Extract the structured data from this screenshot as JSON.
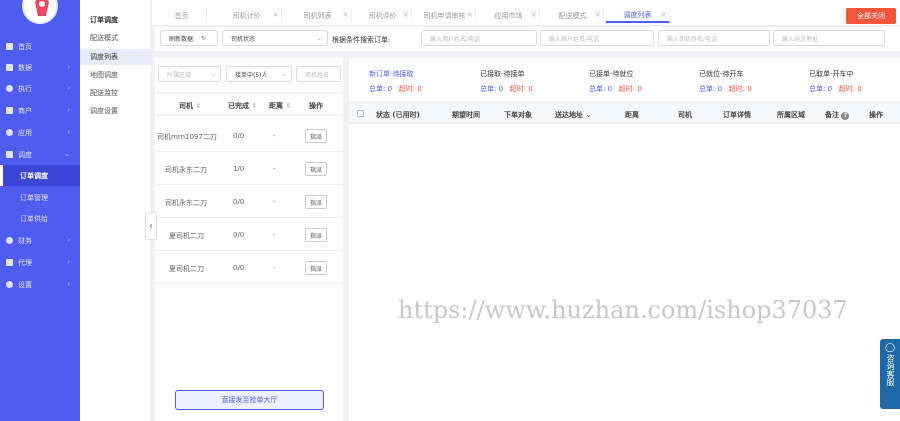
{
  "sidebar": {
    "items": [
      {
        "label": "首页",
        "icon": "home-icon"
      },
      {
        "label": "数据",
        "icon": "chart-icon"
      },
      {
        "label": "执行",
        "icon": "play-icon"
      },
      {
        "label": "商户",
        "icon": "shop-icon"
      },
      {
        "label": "应用",
        "icon": "app-icon"
      },
      {
        "label": "调度",
        "icon": "schedule-icon"
      }
    ],
    "sub_items": [
      {
        "label": "订单调度",
        "active": true
      },
      {
        "label": "订单管理"
      },
      {
        "label": "订单供给"
      }
    ],
    "more_items": [
      {
        "label": "财务",
        "icon": "finance-icon"
      },
      {
        "label": "代理",
        "icon": "agent-icon"
      },
      {
        "label": "设置",
        "icon": "settings-icon"
      }
    ]
  },
  "secondary_nav": {
    "items": [
      {
        "label": "订单调度",
        "head": true
      },
      {
        "label": "配送模式"
      },
      {
        "label": "调度列表",
        "active": true
      },
      {
        "label": "地图调度"
      },
      {
        "label": "配送监控"
      },
      {
        "label": "调度设置"
      }
    ]
  },
  "tabs": [
    {
      "label": "首页"
    },
    {
      "label": "司机计价"
    },
    {
      "label": "司机列表"
    },
    {
      "label": "司机评价"
    },
    {
      "label": "司机申请审核"
    },
    {
      "label": "应用市场"
    },
    {
      "label": "配送模式"
    },
    {
      "label": "调度列表",
      "active": true
    }
  ],
  "close_all_label": "全部关闭",
  "filters": {
    "refresh_label": "刷新数据",
    "status_select": "司机状态",
    "search_prompt": "根据条件搜索订单:",
    "user_placeholder": "输入用户姓名/电话",
    "merchant_placeholder": "输入商户姓名/电话",
    "driver_placeholder": "输入司机姓名/电话",
    "address_placeholder": "输入运送地址"
  },
  "driver_panel": {
    "region_placeholder": "所属区域",
    "accepting_select": "接单中(5)人",
    "driver_name_placeholder": "司机姓名",
    "columns": [
      "司机",
      "已完成",
      "距离",
      "操作"
    ],
    "rows": [
      {
        "name": "司机mrn1097二刀",
        "done": "0/0",
        "distance": "-",
        "action": "指派"
      },
      {
        "name": "司机永东二刀",
        "done": "1/0",
        "distance": "-",
        "action": "指派"
      },
      {
        "name": "司机永东二刀",
        "done": "0/0",
        "distance": "-",
        "action": "指派"
      },
      {
        "name": "夏司机二刀",
        "done": "0/0",
        "distance": "-",
        "action": "指派"
      },
      {
        "name": "夏司机二刀",
        "done": "0/0",
        "distance": "-",
        "action": "指派"
      }
    ],
    "bottom_button": "直接发至抢单大厅"
  },
  "stats": [
    {
      "title": "新订单-待接取",
      "total": "总单: 0",
      "timeout": "超时: 0",
      "highlight": true
    },
    {
      "title": "已接取-待接单",
      "total": "总单: 0",
      "timeout": "超时: 0"
    },
    {
      "title": "已接单-待就位",
      "total": "总单: 0",
      "timeout": "超时: 0"
    },
    {
      "title": "已就位-待开车",
      "total": "总单: 0",
      "timeout": "超时: 0"
    },
    {
      "title": "已取单-开车中",
      "total": "总单: 0",
      "timeout": "超时: 0"
    }
  ],
  "order_table": {
    "columns": [
      "状态 (已用时)",
      "期望时间",
      "下单对象",
      "送达地址",
      "距离",
      "司机",
      "订单详情",
      "所属区域",
      "备注",
      "操作"
    ]
  },
  "watermark": "https://www.huzhan.com/ishop37037",
  "consult_label": "咨询客服",
  "colors": {
    "primary": "#4f5cf0",
    "danger": "#f2543c",
    "sidebar_active": "#3b46d6"
  }
}
